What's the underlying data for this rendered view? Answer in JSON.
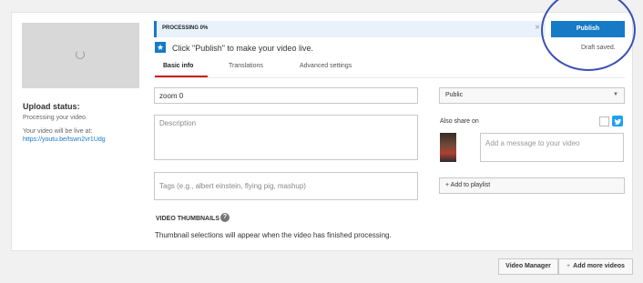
{
  "upload_status": {
    "title": "Upload status:",
    "line1": "Processing your video.",
    "line2": "Your video will be live at:",
    "link": "https://youtu.be/tswn2vr1Udg"
  },
  "processing_bar": {
    "label": "PROCESSING 0%",
    "close": "×",
    "progress_percent": 0
  },
  "hint": {
    "icon": "star-icon",
    "text": "Click \"Publish\" to make your video live."
  },
  "tabs": [
    {
      "label": "Basic info",
      "active": true
    },
    {
      "label": "Translations",
      "active": false
    },
    {
      "label": "Advanced settings",
      "active": false
    }
  ],
  "form": {
    "title_value": "zoom 0",
    "description_placeholder": "Description",
    "tags_placeholder": "Tags (e.g., albert einstein, flying pig, mashup)"
  },
  "thumbnails": {
    "title": "VIDEO THUMBNAILS",
    "help": "?",
    "note": "Thumbnail selections will appear when the video has finished processing."
  },
  "sidebar": {
    "privacy_value": "Public",
    "also_share": "Also share on",
    "message_placeholder": "Add a message to your video",
    "add_to_playlist": "+ Add to playlist"
  },
  "publish": {
    "button": "Publish",
    "status": "Draft saved."
  },
  "footer": {
    "video_manager": "Video Manager",
    "add_more": "Add more videos",
    "add_more_icon": "+"
  },
  "colors": {
    "accent": "#167ac6",
    "tab_active": "#cc181e",
    "annotation": "#3c4fb6"
  }
}
